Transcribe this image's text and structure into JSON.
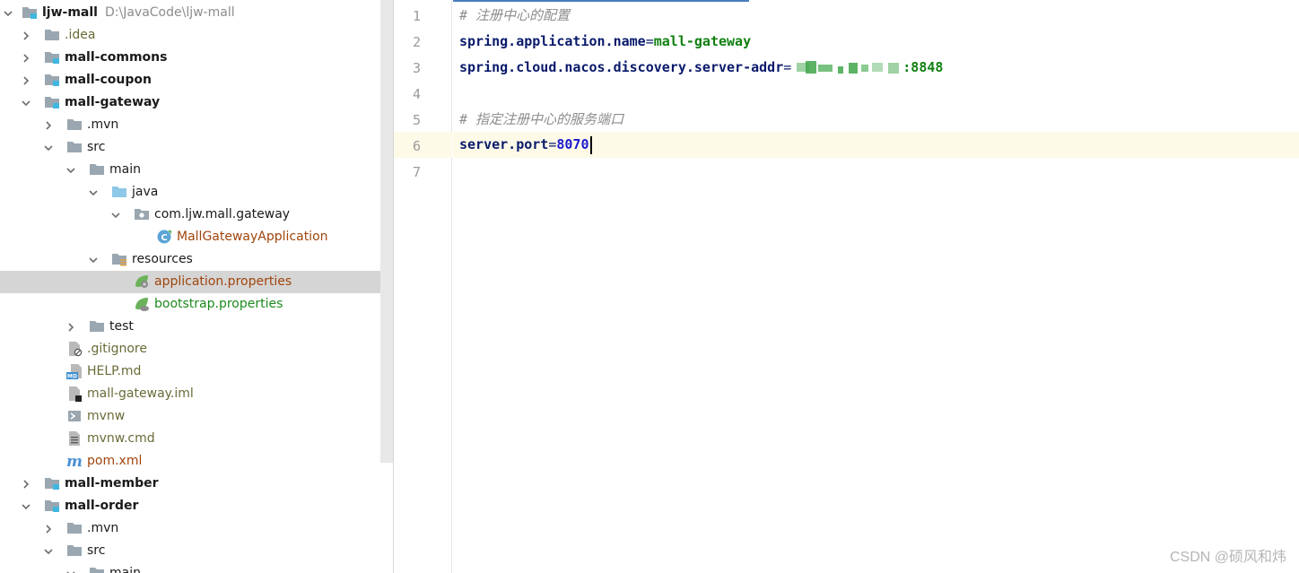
{
  "tree": {
    "root": {
      "label": "ljw-mall",
      "path": "D:\\JavaCode\\ljw-mall"
    },
    "items": [
      {
        "label": ".idea"
      },
      {
        "label": "mall-commons"
      },
      {
        "label": "mall-coupon"
      },
      {
        "label": "mall-gateway"
      },
      {
        "label": ".mvn"
      },
      {
        "label": "src"
      },
      {
        "label": "main"
      },
      {
        "label": "java"
      },
      {
        "label": "com.ljw.mall.gateway"
      },
      {
        "label": "MallGatewayApplication"
      },
      {
        "label": "resources"
      },
      {
        "label": "application.properties"
      },
      {
        "label": "bootstrap.properties"
      },
      {
        "label": "test"
      },
      {
        "label": ".gitignore"
      },
      {
        "label": "HELP.md"
      },
      {
        "label": "mall-gateway.iml"
      },
      {
        "label": "mvnw"
      },
      {
        "label": "mvnw.cmd"
      },
      {
        "label": "pom.xml"
      },
      {
        "label": "mall-member"
      },
      {
        "label": "mall-order"
      },
      {
        "label": ".mvn"
      },
      {
        "label": "src"
      },
      {
        "label": "main"
      }
    ],
    "selected": "application.properties"
  },
  "editor": {
    "line_numbers": [
      "1",
      "2",
      "3",
      "4",
      "5",
      "6",
      "7"
    ],
    "line1_comment": "# 注册中心的配置",
    "line2_key": "spring.application.name",
    "line2_eq": "=",
    "line2_val": "mall-gateway",
    "line3_key": "spring.cloud.nacos.discovery.server-addr",
    "line3_eq": "=",
    "line3_val_suffix": ":8848",
    "line5_comment": "# 指定注册中心的服务端口",
    "line6_key": "server.port",
    "line6_eq": "=",
    "line6_val": "8070",
    "current_line": 6
  },
  "watermark": "CSDN @硕风和炜",
  "colors": {
    "selection": "#d5d5d5",
    "current_line": "#fdfae8",
    "key": "#0a1a6b",
    "value": "#108010",
    "number": "#1a1ad0",
    "comment": "#8c8c8c"
  }
}
